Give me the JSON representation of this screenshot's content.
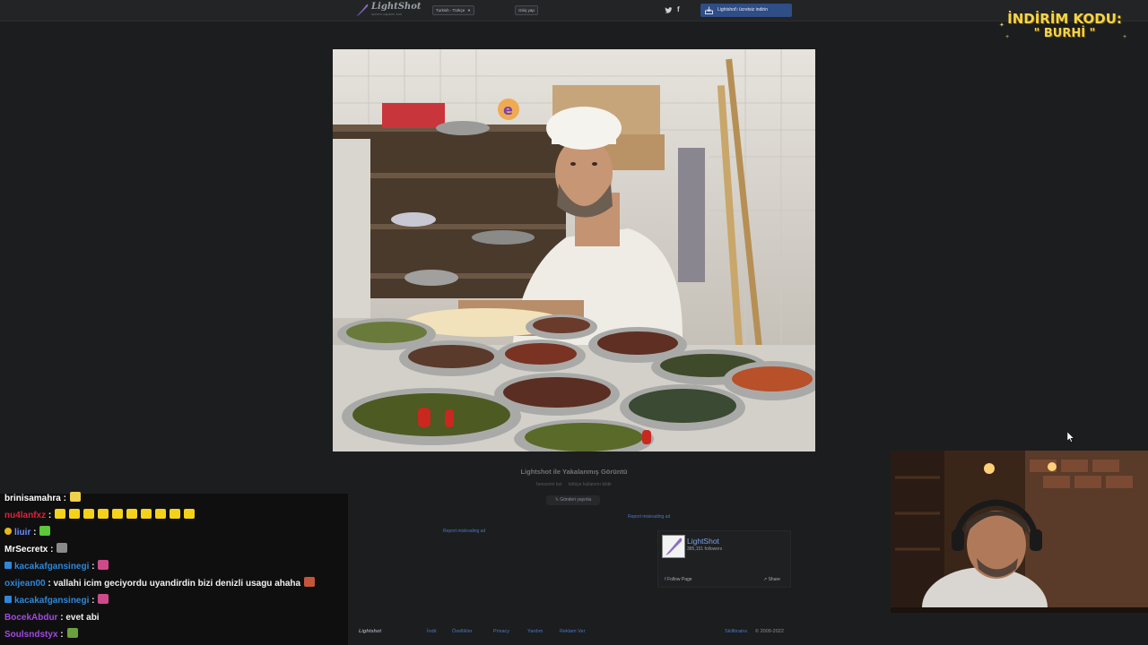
{
  "topbar": {
    "logo_title": "LightShot",
    "logo_subtitle": "screen capture tool",
    "language": "Turkish - Türkçe",
    "login": "Giriş yap",
    "download": "Lightshot'ı ücretsiz indirin"
  },
  "caption": "Lightshot ile Yakalanmış Görüntü",
  "meta": {
    "similar": "benzerini bul",
    "report": "kötüye kullanımı bildir"
  },
  "post_button": "Gönderi yayınla",
  "ads": {
    "link1": "Report misleading ad",
    "link2": "Report misleading ad"
  },
  "fb_widget": {
    "name": "LightShot",
    "followers": "385,151 followers",
    "follow": "Follow Page",
    "share": "Share"
  },
  "footer": {
    "brand": "Lightshot",
    "links": [
      "İndir",
      "Özellikler",
      "Privacy",
      "Yardım",
      "Reklam Ver"
    ],
    "copyright_link": "Skillbrains",
    "copyright": "© 2009-2022"
  },
  "promo": {
    "line1": "İNDİRİM KODU:",
    "line2": "\" BURHİ \""
  },
  "chat": [
    {
      "user": "brinisamahra",
      "user_color": "#ffffff",
      "message": "",
      "emotes": [
        "#f2d14a"
      ]
    },
    {
      "user": "nu4lanfxz",
      "user_color": "#e0223a",
      "message": "",
      "emotes": [
        "#f5d21a",
        "#f5d21a",
        "#f5d21a",
        "#f5d21a",
        "#f5d21a",
        "#f5d21a",
        "#f5d21a",
        "#f5d21a",
        "#f5d21a",
        "#f5d21a"
      ]
    },
    {
      "user": "liuir",
      "user_color": "#6a8fff",
      "message": "",
      "emotes": [
        "#5cc83a"
      ]
    },
    {
      "user": "MrSecretx",
      "user_color": "#ffffff",
      "message": "",
      "emotes": [
        "#8a8a8a"
      ]
    },
    {
      "user": "kacakafgansinegi",
      "user_color": "#2f87d8",
      "message": "",
      "emotes": [
        "#d04a8a"
      ]
    },
    {
      "user": "oxijean00",
      "user_color": "#2f87d8",
      "message": "vallahi icim geciyordu uyandirdin bizi denizli usagu ahaha",
      "emotes": [
        "#c4553a"
      ]
    },
    {
      "user": "kacakafgansinegi",
      "user_color": "#2f87d8",
      "message": "",
      "emotes": [
        "#d04a8a"
      ]
    },
    {
      "user": "BocekAbdur",
      "user_color": "#a14ae0",
      "message": "evet abi",
      "emotes": []
    },
    {
      "user": "Soulsndstyx",
      "user_color": "#a14ae0",
      "message": "",
      "emotes": [
        "#6aa040"
      ]
    }
  ]
}
